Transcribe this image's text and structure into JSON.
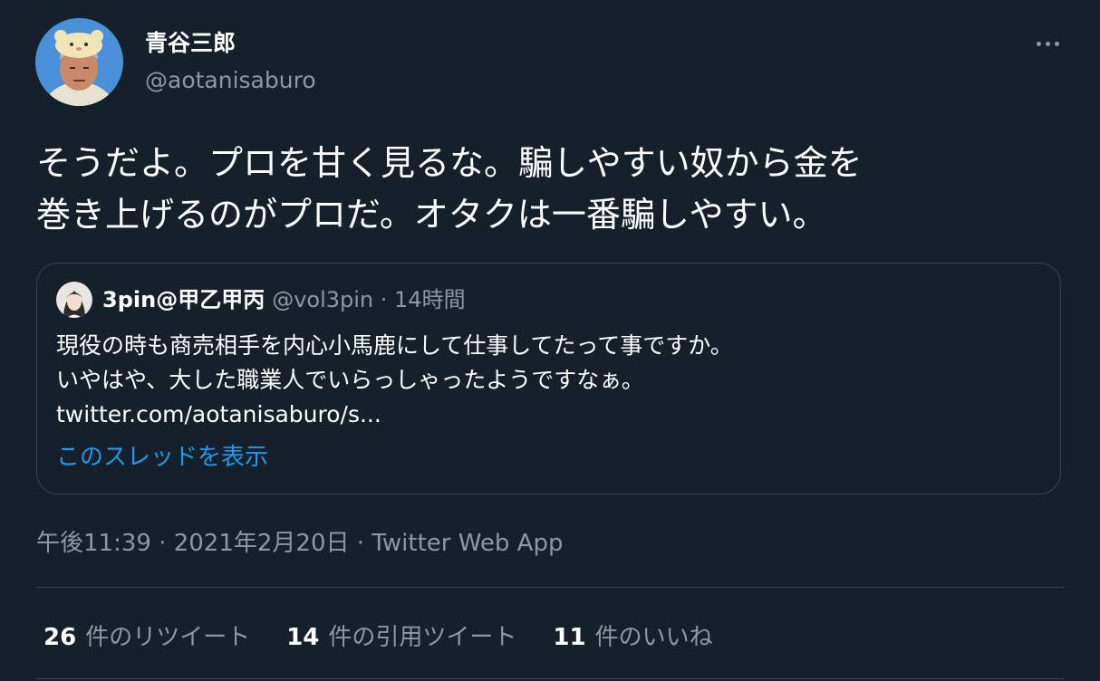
{
  "author": {
    "display_name": "青谷三郎",
    "handle": "@aotanisaburo"
  },
  "tweet": {
    "text_lines": [
      "そうだよ。プロを甘く見るな。騙しやすい奴から金を",
      "巻き上げるのがプロだ。オタクは一番騙しやすい。"
    ]
  },
  "quote": {
    "display_name": "3pin@甲乙甲丙",
    "meta": "@vol3pin · 14時間",
    "body_lines": [
      "現役の時も商売相手を内心小馬鹿にして仕事してたって事ですか。",
      "いやはや、大した職業人でいらっしゃったようですなぁ。",
      "twitter.com/aotanisaburo/s..."
    ],
    "show_thread_label": "このスレッドを表示"
  },
  "timestamp": "午後11:39 · 2021年2月20日 · Twitter Web App",
  "stats": [
    {
      "count": "26",
      "label": "件のリツイート"
    },
    {
      "count": "14",
      "label": "件の引用ツイート"
    },
    {
      "count": "11",
      "label": "件のいいね"
    }
  ],
  "icons": {
    "more": "more-horizontal-icon"
  },
  "colors": {
    "background": "#15202b",
    "primary_text": "#ffffff",
    "secondary_text": "#8b98a5",
    "link": "#1d9bf0",
    "border": "#38444d"
  }
}
